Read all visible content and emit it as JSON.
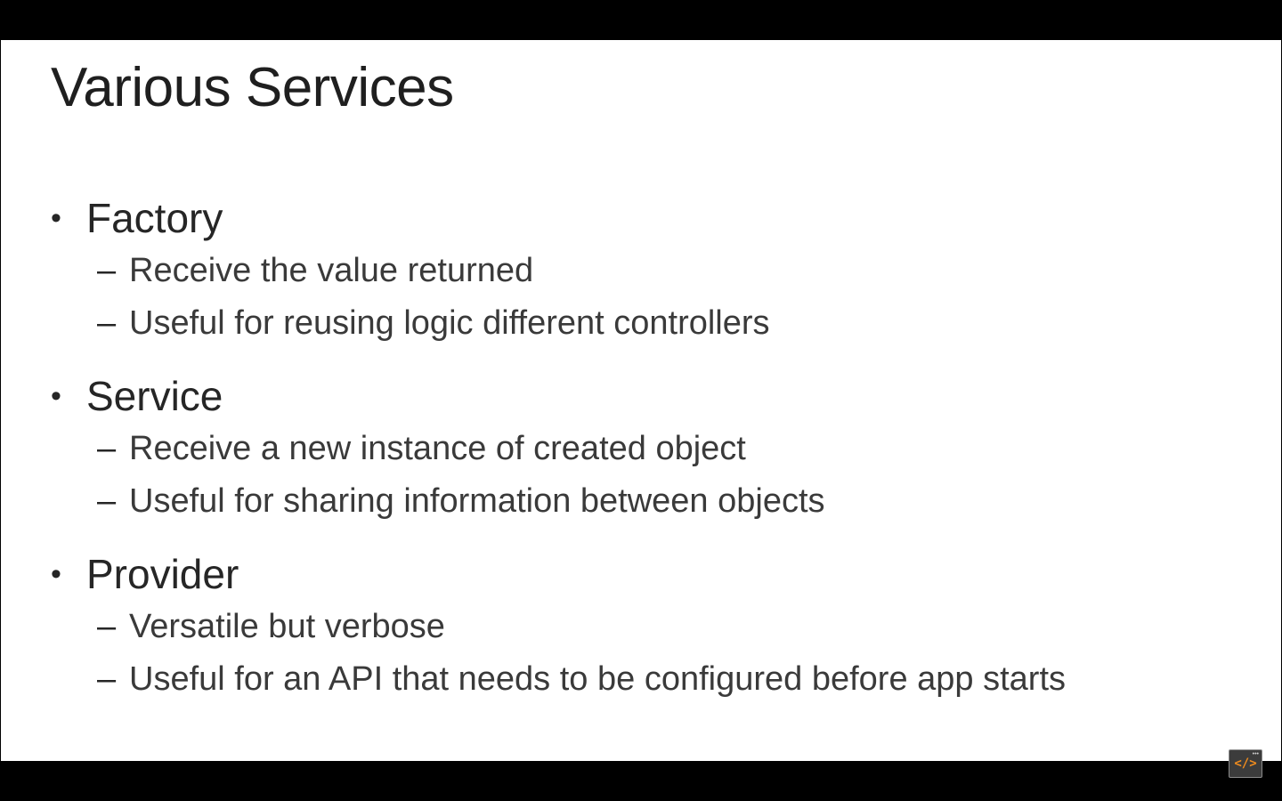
{
  "slide": {
    "title": "Various Services",
    "bullets": [
      {
        "label": "Factory",
        "subitems": [
          "Receive the value returned",
          "Useful for reusing logic different controllers"
        ]
      },
      {
        "label": "Service",
        "subitems": [
          "Receive a new instance of created object",
          "Useful for sharing information between objects"
        ]
      },
      {
        "label": "Provider",
        "subitems": [
          "Versatile but verbose",
          "Useful for an API that needs to be configured before app starts"
        ]
      }
    ],
    "bullet_glyph": "•",
    "dash_glyph": "–"
  },
  "badge": {
    "icon": "code-icon",
    "glyph": "</>",
    "dots": "•••",
    "accent_color": "#f08c1e"
  }
}
